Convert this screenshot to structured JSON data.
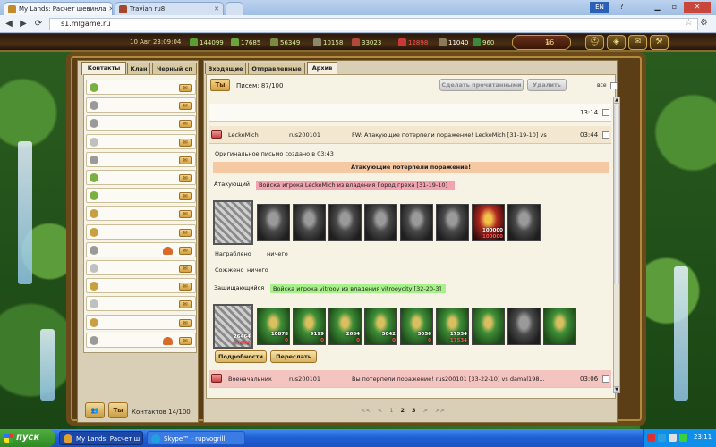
{
  "browser": {
    "tabs": [
      {
        "label": "My Lands: Расчет шевинла"
      },
      {
        "label": "Travian ru8"
      }
    ],
    "lang": "EN",
    "url": "s1.mlgame.ru"
  },
  "game": {
    "clock": "10 Авг 23:09:04",
    "resources": [
      "144099",
      "17685",
      "56349",
      "10158",
      "33023",
      "12898",
      "11040",
      "960"
    ],
    "badge": "16"
  },
  "left": {
    "tabs": [
      "Контакты",
      "Клан",
      "Черный сп"
    ],
    "count_label": "Контактов 14/100",
    "btn_write": "Ты"
  },
  "right": {
    "tabs": [
      "Входящие",
      "Отправленные",
      "Архив"
    ],
    "mail_icon": "Ты",
    "letters": "Писем: 87/100",
    "btn_read": "Сделать прочитанными",
    "btn_delete": "Удалить",
    "all": "все",
    "messages": [
      {
        "from": "",
        "who": "",
        "subject": "",
        "time": "13:14"
      },
      {
        "from": "LeckeMich",
        "who": "rus200101",
        "subject": "FW: Атакующие потерпели поражение! LeckeMich [31-19-10] vs...",
        "time": "03:44"
      },
      {
        "from": "Военачальник",
        "who": "rus200101",
        "subject": "Вы потерпели поражение! rus200101 [33-22-10] vs damal198...",
        "time": "03:06"
      }
    ],
    "report": {
      "origin": "Оригинальное письмо создано в 03:43",
      "banner": "Атакующие потерпели поражение!",
      "attacker_label": "Атакующий",
      "attacker_army": "Войска игрока LeckeMich из владения Город греха [31-19-10]",
      "looted_label": "Награблено",
      "looted_value": "ничего",
      "burned_label": "Сожжено",
      "burned_value": "ничего",
      "defender_label": "Защищающийся",
      "defender_army": "Войска игрока vitrooy из владения vitrooycity [32-20-3]",
      "attacker_units": [
        {
          "a": ""
        },
        {
          "a": ""
        },
        {
          "a": ""
        },
        {
          "a": ""
        },
        {
          "a": ""
        },
        {
          "a": ""
        },
        {
          "a": ""
        },
        {
          "a": "100000",
          "b": "100000"
        },
        {
          "a": ""
        }
      ],
      "defender_units": [
        {
          "a": "26464",
          "b": "26464"
        },
        {
          "a": "10878",
          "b": "0"
        },
        {
          "a": "9199",
          "b": "0"
        },
        {
          "a": "2684",
          "b": "0"
        },
        {
          "a": "5042",
          "b": "0"
        },
        {
          "a": "5056",
          "b": "0"
        },
        {
          "a": "17534",
          "b": "17534"
        },
        {
          "a": ""
        },
        {
          "a": ""
        },
        {
          "a": ""
        }
      ],
      "btn_details": "Подробности",
      "btn_forward": "Переслать"
    },
    "pager": {
      "first": "<<",
      "prev": "<",
      "pages": [
        "1",
        "2",
        "3"
      ],
      "next": ">",
      "last": ">>"
    }
  },
  "taskbar": {
    "start": "пуск",
    "tasks": [
      "My Lands: Расчет ш...",
      "Skype™ - rupvogrill"
    ],
    "clock": "23:11"
  }
}
